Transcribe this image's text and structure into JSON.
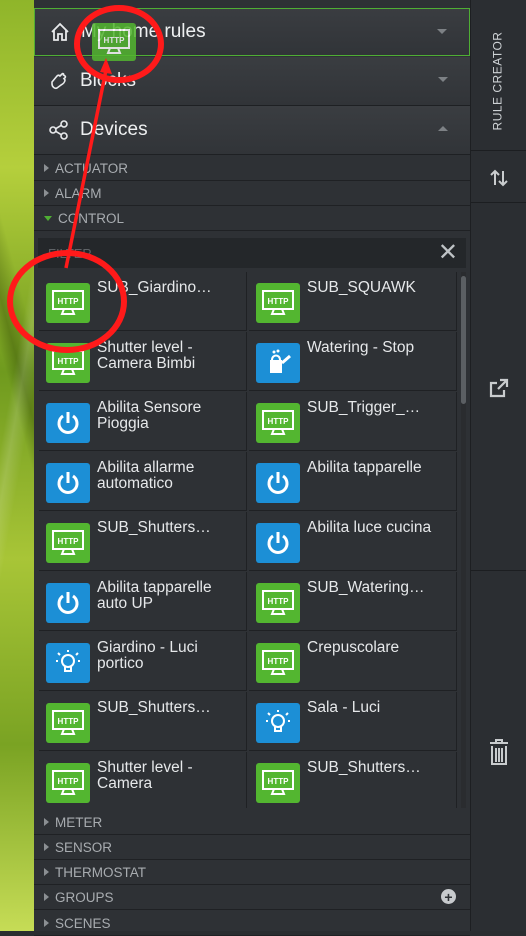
{
  "accordion": {
    "my_home_rules": "My home rules",
    "blocks": "Blocks",
    "devices": "Devices"
  },
  "categories": {
    "actuator": "ACTUATOR",
    "alarm": "ALARM",
    "control": "CONTROL",
    "meter": "METER",
    "sensor": "SENSOR",
    "thermostat": "THERMOSTAT",
    "groups": "GROUPS",
    "scenes": "SCENES"
  },
  "filter": {
    "placeholder": "FILTER"
  },
  "side": {
    "rule_creator": "RULE CREATOR"
  },
  "http_text": "HTTP",
  "colors": {
    "http_green": "#53b630",
    "control_blue": "#1c8fd6",
    "annotation_red": "#ff1a1a",
    "active_border": "#4fae34"
  },
  "devices": [
    {
      "label": "SUB_Giardino…",
      "icon": "http-icon"
    },
    {
      "label": "SUB_SQUAWK",
      "icon": "http-icon"
    },
    {
      "label": "Shutter level - Camera Bimbi",
      "icon": "http-icon"
    },
    {
      "label": "Watering - Stop",
      "icon": "watering-can-icon"
    },
    {
      "label": "Abilita Sensore Pioggia",
      "icon": "power-icon"
    },
    {
      "label": "SUB_Trigger_…",
      "icon": "http-icon"
    },
    {
      "label": "Abilita allarme automatico",
      "icon": "power-icon"
    },
    {
      "label": "Abilita tapparelle",
      "icon": "power-icon"
    },
    {
      "label": "SUB_Shutters…",
      "icon": "http-icon"
    },
    {
      "label": "Abilita luce cucina",
      "icon": "power-icon"
    },
    {
      "label": "Abilita tapparelle auto UP",
      "icon": "power-icon"
    },
    {
      "label": "SUB_Watering…",
      "icon": "http-icon"
    },
    {
      "label": "Giardino - Luci portico",
      "icon": "bulb-icon"
    },
    {
      "label": "Crepuscolare",
      "icon": "http-icon"
    },
    {
      "label": "SUB_Shutters…",
      "icon": "http-icon"
    },
    {
      "label": "Sala - Luci",
      "icon": "bulb-icon"
    },
    {
      "label": "Shutter level - Camera",
      "icon": "http-icon"
    },
    {
      "label": "SUB_Shutters…",
      "icon": "http-icon"
    }
  ]
}
